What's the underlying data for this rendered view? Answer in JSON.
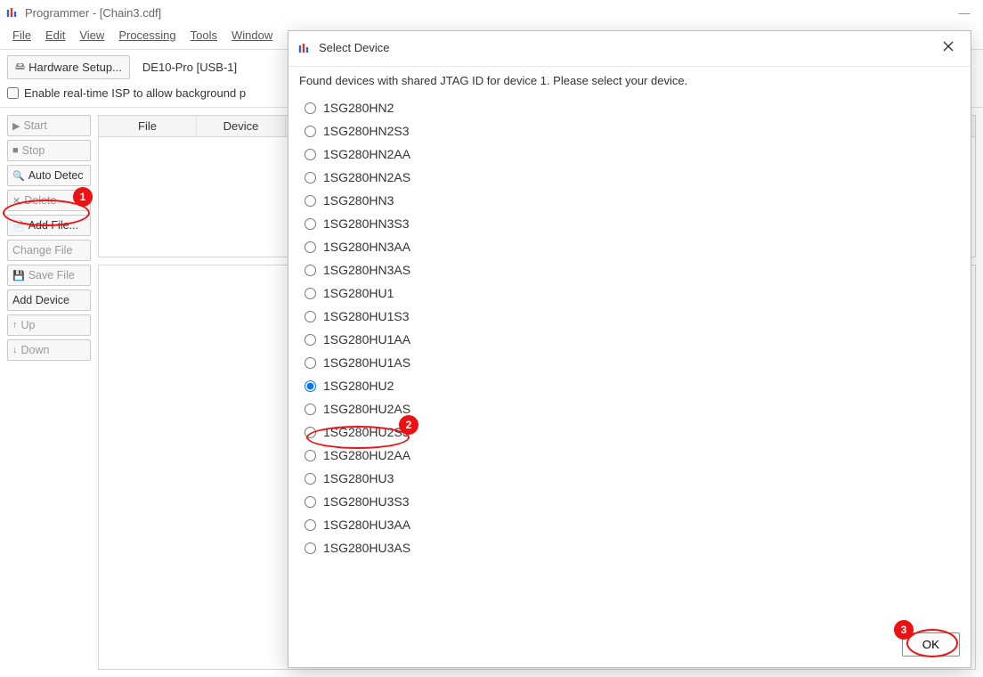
{
  "window_title": "Programmer - [Chain3.cdf]",
  "menu": [
    "File",
    "Edit",
    "View",
    "Processing",
    "Tools",
    "Window"
  ],
  "toolbar": {
    "hardware_setup": "Hardware Setup...",
    "hardware_readout": "DE10-Pro [USB-1]"
  },
  "check_row": {
    "enable_isp": "Enable real-time ISP to allow background p"
  },
  "side_buttons": {
    "start": "Start",
    "stop": "Stop",
    "auto_detect": "Auto Detec",
    "delete": "Delete",
    "add_file": "Add File...",
    "change_file": "Change File",
    "save_file": "Save File",
    "add_device": "Add Device",
    "up": "Up",
    "down": "Down"
  },
  "table_headers": {
    "file": "File",
    "device": "Device"
  },
  "modal": {
    "title": "Select Device",
    "message": "Found devices with shared JTAG ID for device 1. Please select your device.",
    "ok": "OK"
  },
  "devices": [
    "1SG280HN2",
    "1SG280HN2S3",
    "1SG280HN2AA",
    "1SG280HN2AS",
    "1SG280HN3",
    "1SG280HN3S3",
    "1SG280HN3AA",
    "1SG280HN3AS",
    "1SG280HU1",
    "1SG280HU1S3",
    "1SG280HU1AA",
    "1SG280HU1AS",
    "1SG280HU2",
    "1SG280HU2AS",
    "1SG280HU2S3",
    "1SG280HU2AA",
    "1SG280HU3",
    "1SG280HU3S3",
    "1SG280HU3AA",
    "1SG280HU3AS"
  ],
  "selected_device_index": 12,
  "callouts": {
    "c1": "1",
    "c2": "2",
    "c3": "3"
  }
}
